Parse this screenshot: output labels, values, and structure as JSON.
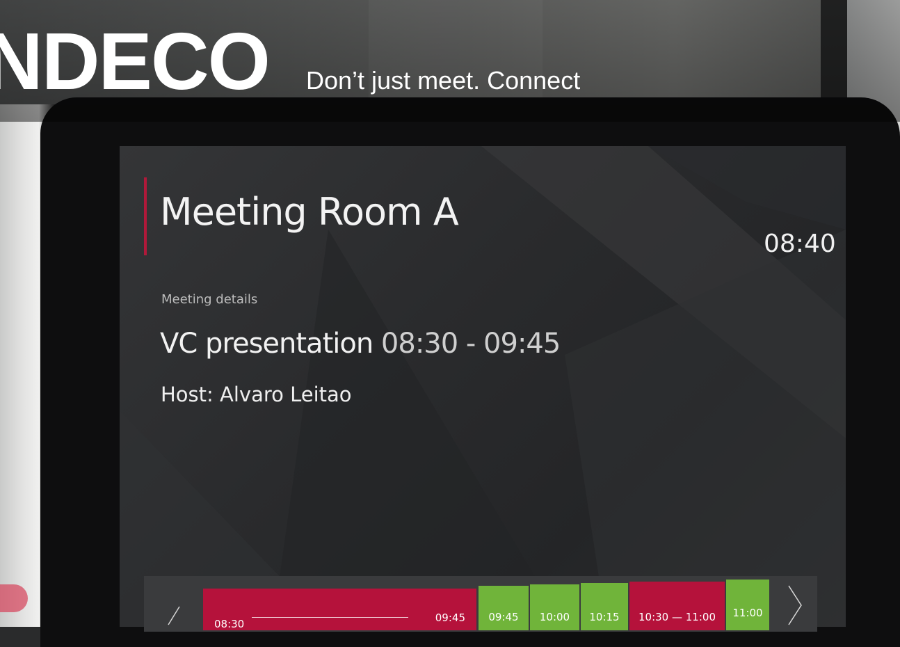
{
  "banner": {
    "brand": "NDECO",
    "tagline": "Don’t just meet. Connect"
  },
  "room_panel": {
    "room_name": "Meeting Room A",
    "clock": "08:40",
    "details_label": "Meeting details",
    "meeting_title": "VC presentation",
    "meeting_time": "08:30 - 09:45",
    "host_line": "Host:  Alvaro Leitao"
  },
  "timeline": {
    "current_booking": {
      "from": "08:30",
      "to": "09:45"
    },
    "slots": [
      {
        "label": "09:45",
        "status": "free"
      },
      {
        "label": "10:00",
        "status": "free"
      },
      {
        "label": "10:15",
        "status": "free"
      },
      {
        "label": "10:30 — 11:00",
        "status": "booked"
      },
      {
        "label": "11:00",
        "status": "free"
      }
    ]
  },
  "colors": {
    "accent_red": "#b5123b",
    "free_green": "#70b43a",
    "screen_bg": "#2a2b2d"
  },
  "icons": {
    "prev": "chevron-left-icon",
    "next": "chevron-right-icon"
  }
}
